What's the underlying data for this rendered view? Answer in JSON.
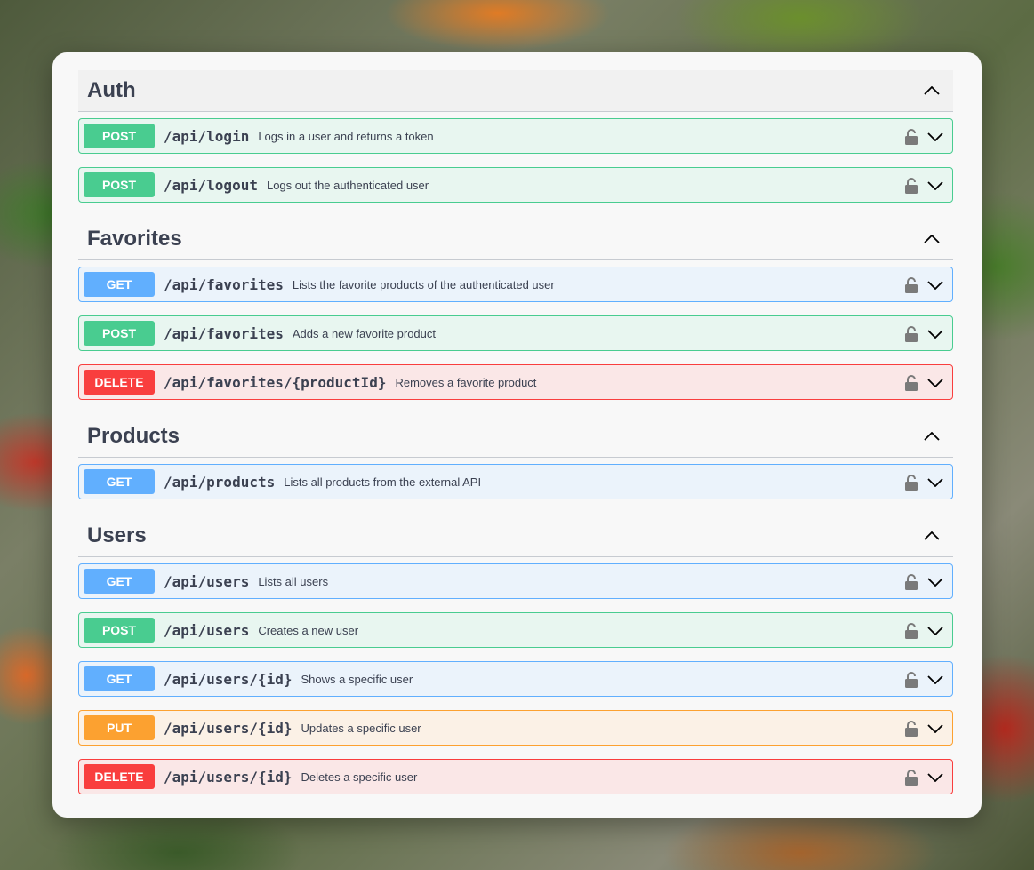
{
  "sections": [
    {
      "title": "Auth",
      "operations": [
        {
          "method": "POST",
          "path": "/api/login",
          "summary": "Logs in a user and returns a token"
        },
        {
          "method": "POST",
          "path": "/api/logout",
          "summary": "Logs out the authenticated user"
        }
      ]
    },
    {
      "title": "Favorites",
      "operations": [
        {
          "method": "GET",
          "path": "/api/favorites",
          "summary": "Lists the favorite products of the authenticated user"
        },
        {
          "method": "POST",
          "path": "/api/favorites",
          "summary": "Adds a new favorite product"
        },
        {
          "method": "DELETE",
          "path": "/api/favorites/{productId}",
          "summary": "Removes a favorite product"
        }
      ]
    },
    {
      "title": "Products",
      "operations": [
        {
          "method": "GET",
          "path": "/api/products",
          "summary": "Lists all products from the external API"
        }
      ]
    },
    {
      "title": "Users",
      "operations": [
        {
          "method": "GET",
          "path": "/api/users",
          "summary": "Lists all users"
        },
        {
          "method": "POST",
          "path": "/api/users",
          "summary": "Creates a new user"
        },
        {
          "method": "GET",
          "path": "/api/users/{id}",
          "summary": "Shows a specific user"
        },
        {
          "method": "PUT",
          "path": "/api/users/{id}",
          "summary": "Updates a specific user"
        },
        {
          "method": "DELETE",
          "path": "/api/users/{id}",
          "summary": "Deletes a specific user"
        }
      ]
    }
  ],
  "colors": {
    "post": "#49cc90",
    "get": "#61affe",
    "delete": "#f93e3e",
    "put": "#fca130",
    "text": "#3b4151"
  },
  "icons": {
    "section_toggle": "chevron-up-icon",
    "operation_lock": "lock-icon",
    "operation_expand": "chevron-down-icon"
  }
}
